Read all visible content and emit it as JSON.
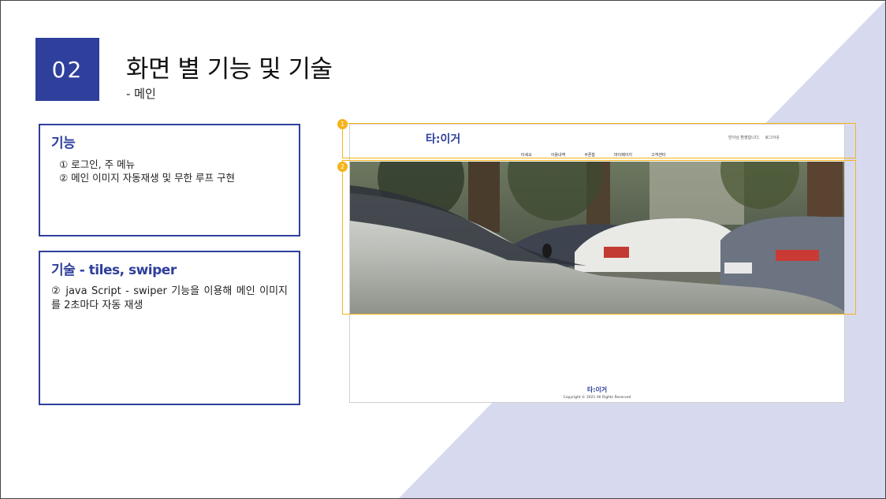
{
  "slide": {
    "number": "02",
    "title": "화면 별 기능 및 기술",
    "subtitle": "- 메인"
  },
  "cards": {
    "feature": {
      "heading": "기능",
      "items": [
        "① 로그인, 주 메뉴",
        "② 메인 이미지 자동재생 및 무한 루프 구현"
      ]
    },
    "tech": {
      "heading": "기술 - tiles, swiper",
      "text": "② java Script - swiper 기능을 이용해 메인 이미지를 2초마다 자동 재생"
    }
  },
  "mockup": {
    "logo": "타:이거",
    "util": [
      "반이님 환영합니다.",
      "로그아웃"
    ],
    "nav": [
      "타세요",
      "이용내역",
      "쿠폰함",
      "마이페이지",
      "고객센터"
    ],
    "footer_logo": "타:이거",
    "copyright": "Copyright © 2021 All Rights Reserved"
  },
  "callouts": [
    "1",
    "2"
  ],
  "colors": {
    "accent": "#2e3f9c",
    "highlight": "#f5b31a",
    "background_triangle": "#d7daee"
  }
}
